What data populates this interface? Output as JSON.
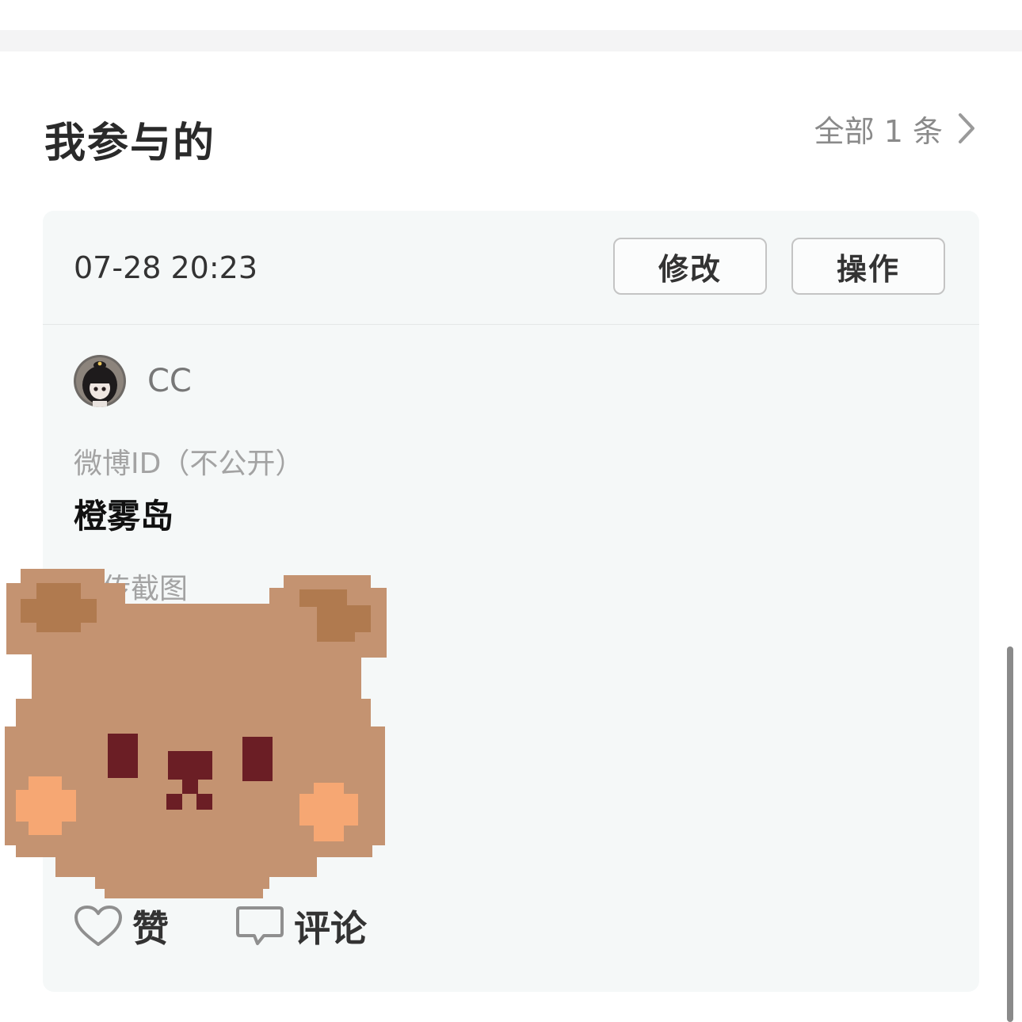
{
  "section": {
    "title": "我参与的",
    "view_all": "全部 1 条"
  },
  "card": {
    "timestamp": "07-28 20:23",
    "edit_label": "修改",
    "operate_label": "操作",
    "username": "CC",
    "weibo_id_label": "微博ID（不公开）",
    "weibo_id_value": "橙雾岛",
    "screenshot_label": "上传截图"
  },
  "actions": {
    "like_label": "赞",
    "comment_label": "评论"
  },
  "icons": {
    "chevron": "chevron-right-icon",
    "like": "heart-outline-icon",
    "comment": "comment-bubble-icon",
    "sticker": "pixel-bear-sticker"
  },
  "colors": {
    "card_bg": "#f5f8f8",
    "bear_body": "#c49371",
    "bear_ear_inner": "#b07a4f",
    "bear_features": "#6b1e25",
    "bear_cheek": "#f6a773"
  }
}
